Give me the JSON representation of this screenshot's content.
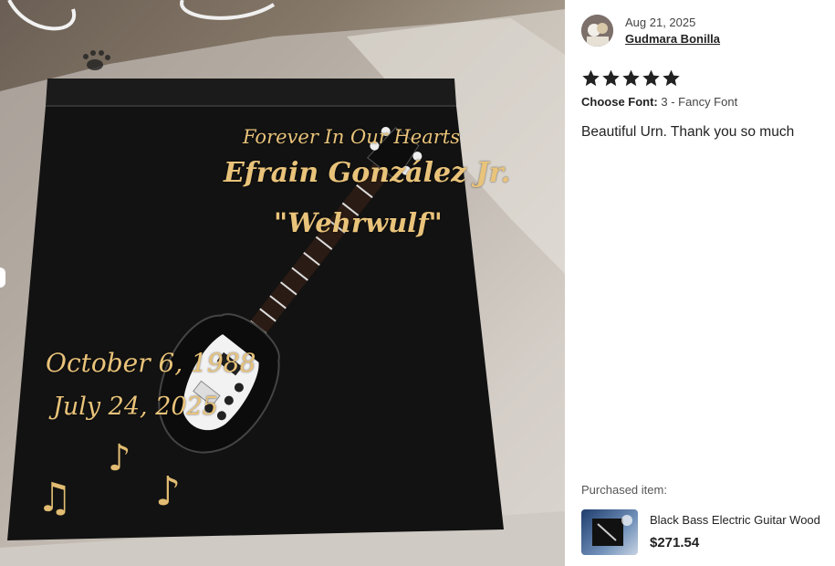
{
  "photo": {
    "inscription": {
      "forever": "Forever In Our Hearts",
      "name": "Efrain González Jr.",
      "nickname": "\"Wehrwulf\"",
      "birth": "October 6, 1988",
      "death": "July 24, 2025"
    },
    "notes": [
      "♪",
      "♫",
      "♪"
    ]
  },
  "review": {
    "avatar": "avatar-photo",
    "date": "Aug 21, 2025",
    "reviewer": "Gudmara Bonilla",
    "rating": 5,
    "star_color": "#222222",
    "variation_label": "Choose Font:",
    "variation_value": "3 - Fancy Font",
    "text": "Beautiful Urn. Thank you so much"
  },
  "purchased": {
    "label": "Purchased item:",
    "title": "Black Bass Electric Guitar Wood",
    "price": "$271.54"
  }
}
